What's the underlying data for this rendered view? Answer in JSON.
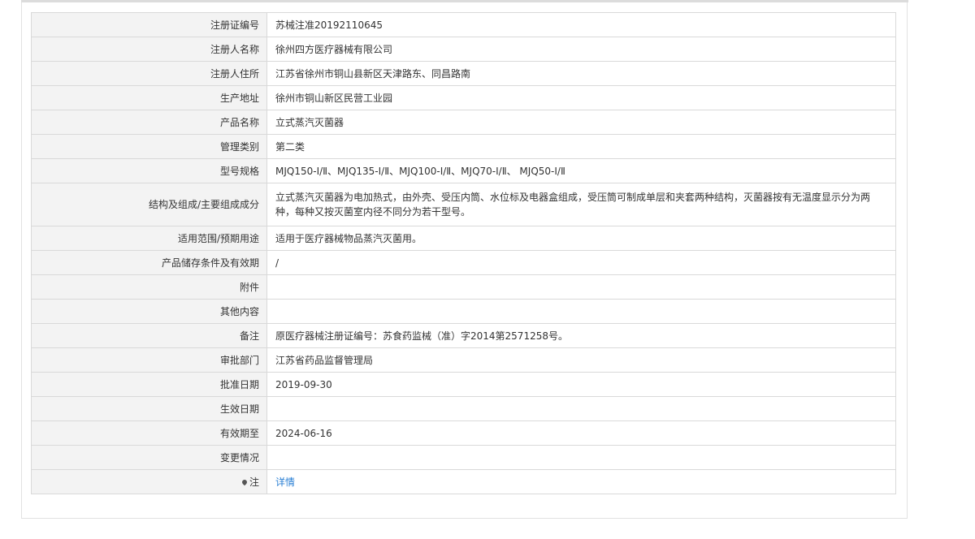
{
  "rows": [
    {
      "label": "注册证编号",
      "value": "苏械注准20192110645"
    },
    {
      "label": "注册人名称",
      "value": "徐州四方医疗器械有限公司"
    },
    {
      "label": "注册人住所",
      "value": "江苏省徐州市铜山县新区天津路东、同昌路南"
    },
    {
      "label": "生产地址",
      "value": "徐州市铜山新区民营工业园"
    },
    {
      "label": "产品名称",
      "value": "立式蒸汽灭菌器"
    },
    {
      "label": "管理类别",
      "value": "第二类"
    },
    {
      "label": "型号规格",
      "value": "MJQ150-Ⅰ/Ⅱ、MJQ135-Ⅰ/Ⅱ、MJQ100-Ⅰ/Ⅱ、MJQ70-Ⅰ/Ⅱ、 MJQ50-Ⅰ/Ⅱ"
    },
    {
      "label": "结构及组成/主要组成成分",
      "value": "立式蒸汽灭菌器为电加热式，由外壳、受压内筒、水位标及电器盒组成，受压筒可制成单层和夹套两种结构，灭菌器按有无温度显示分为两种，每种又按灭菌室内径不同分为若干型号。"
    },
    {
      "label": "适用范围/预期用途",
      "value": "适用于医疗器械物品蒸汽灭菌用。"
    },
    {
      "label": "产品储存条件及有效期",
      "value": "/"
    },
    {
      "label": "附件",
      "value": ""
    },
    {
      "label": "其他内容",
      "value": ""
    },
    {
      "label": "备注",
      "value": "原医疗器械注册证编号：苏食药监械（准）字2014第2571258号。"
    },
    {
      "label": "审批部门",
      "value": "江苏省药品监督管理局"
    },
    {
      "label": "批准日期",
      "value": "2019-09-30"
    },
    {
      "label": "生效日期",
      "value": ""
    },
    {
      "label": "有效期至",
      "value": "2024-06-16"
    },
    {
      "label": "变更情况",
      "value": ""
    }
  ],
  "note_row": {
    "label": "注",
    "icon": "pin-icon",
    "link_text": "详情"
  }
}
